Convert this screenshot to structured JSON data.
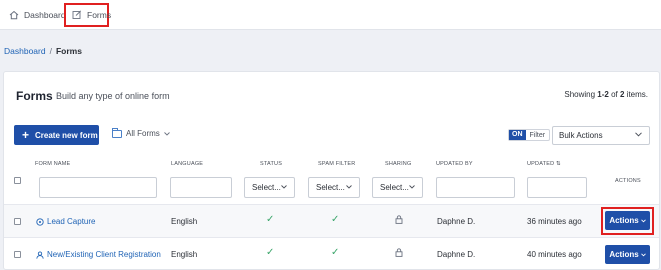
{
  "topnav": {
    "items": [
      {
        "label": "Dashboard",
        "icon": "home-icon"
      },
      {
        "label": "Forms",
        "icon": "edit-form-icon"
      }
    ]
  },
  "breadcrumb": {
    "link": "Dashboard",
    "separator": "/",
    "current": "Forms"
  },
  "page": {
    "title": "Forms",
    "subtitle": "Build any type of online form",
    "showing_prefix": "Showing ",
    "showing_range": "1-2",
    "showing_of": " of ",
    "showing_total": "2",
    "showing_suffix": " items."
  },
  "toolbar": {
    "create_label": "Create new form",
    "all_forms_label": "All Forms",
    "toggle_state": "ON",
    "toggle_label": "Filter",
    "bulk_label": "Bulk Actions"
  },
  "table": {
    "columns": [
      "FORM NAME",
      "LANGUAGE",
      "STATUS",
      "SPAM FILTER",
      "SHARING",
      "UPDATED BY",
      "UPDATED",
      "ACTIONS"
    ],
    "filter_select_placeholder": "Select...",
    "rows": [
      {
        "name": "Lead Capture",
        "language": "English",
        "updated_by": "Daphne D.",
        "updated": "36 minutes ago",
        "actions": "Actions"
      },
      {
        "name": "New/Existing Client Registration",
        "language": "English",
        "updated_by": "Daphne D.",
        "updated": "40 minutes ago",
        "actions": "Actions"
      }
    ]
  },
  "colors": {
    "primary": "#1f4fa8",
    "link": "#1f63b5",
    "success": "#3ca66b",
    "highlight": "#e02020"
  }
}
